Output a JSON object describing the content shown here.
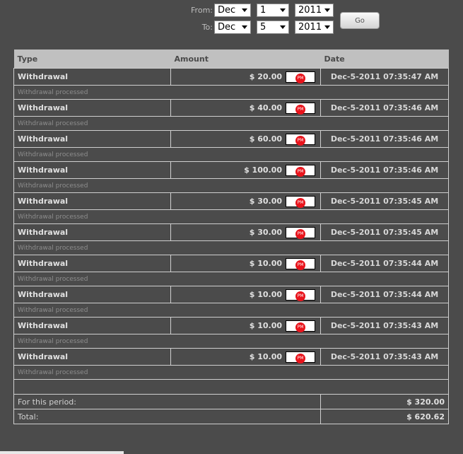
{
  "filters": {
    "from_label": "From:",
    "to_label": "To:",
    "from": {
      "month": "Dec",
      "day": "1",
      "year": "2011"
    },
    "to": {
      "month": "Dec",
      "day": "5",
      "year": "2011"
    },
    "go_label": "Go"
  },
  "table": {
    "headers": {
      "type": "Type",
      "amount": "Amount",
      "date": "Date"
    },
    "pm_badge": "PM",
    "rows": [
      {
        "type": "Withdrawal",
        "amount": "$ 20.00",
        "date": "Dec-5-2011 07:35:47 AM",
        "note": "Withdrawal processed"
      },
      {
        "type": "Withdrawal",
        "amount": "$ 40.00",
        "date": "Dec-5-2011 07:35:46 AM",
        "note": "Withdrawal processed"
      },
      {
        "type": "Withdrawal",
        "amount": "$ 60.00",
        "date": "Dec-5-2011 07:35:46 AM",
        "note": "Withdrawal processed"
      },
      {
        "type": "Withdrawal",
        "amount": "$ 100.00",
        "date": "Dec-5-2011 07:35:46 AM",
        "note": "Withdrawal processed"
      },
      {
        "type": "Withdrawal",
        "amount": "$ 30.00",
        "date": "Dec-5-2011 07:35:45 AM",
        "note": "Withdrawal processed"
      },
      {
        "type": "Withdrawal",
        "amount": "$ 30.00",
        "date": "Dec-5-2011 07:35:45 AM",
        "note": "Withdrawal processed"
      },
      {
        "type": "Withdrawal",
        "amount": "$ 10.00",
        "date": "Dec-5-2011 07:35:44 AM",
        "note": "Withdrawal processed"
      },
      {
        "type": "Withdrawal",
        "amount": "$ 10.00",
        "date": "Dec-5-2011 07:35:44 AM",
        "note": "Withdrawal processed"
      },
      {
        "type": "Withdrawal",
        "amount": "$ 10.00",
        "date": "Dec-5-2011 07:35:43 AM",
        "note": "Withdrawal processed"
      },
      {
        "type": "Withdrawal",
        "amount": "$ 10.00",
        "date": "Dec-5-2011 07:35:43 AM",
        "note": "Withdrawal processed"
      }
    ],
    "period_label": "For this period:",
    "period_value": "$ 320.00",
    "total_label": "Total:",
    "total_value": "$ 620.62"
  }
}
